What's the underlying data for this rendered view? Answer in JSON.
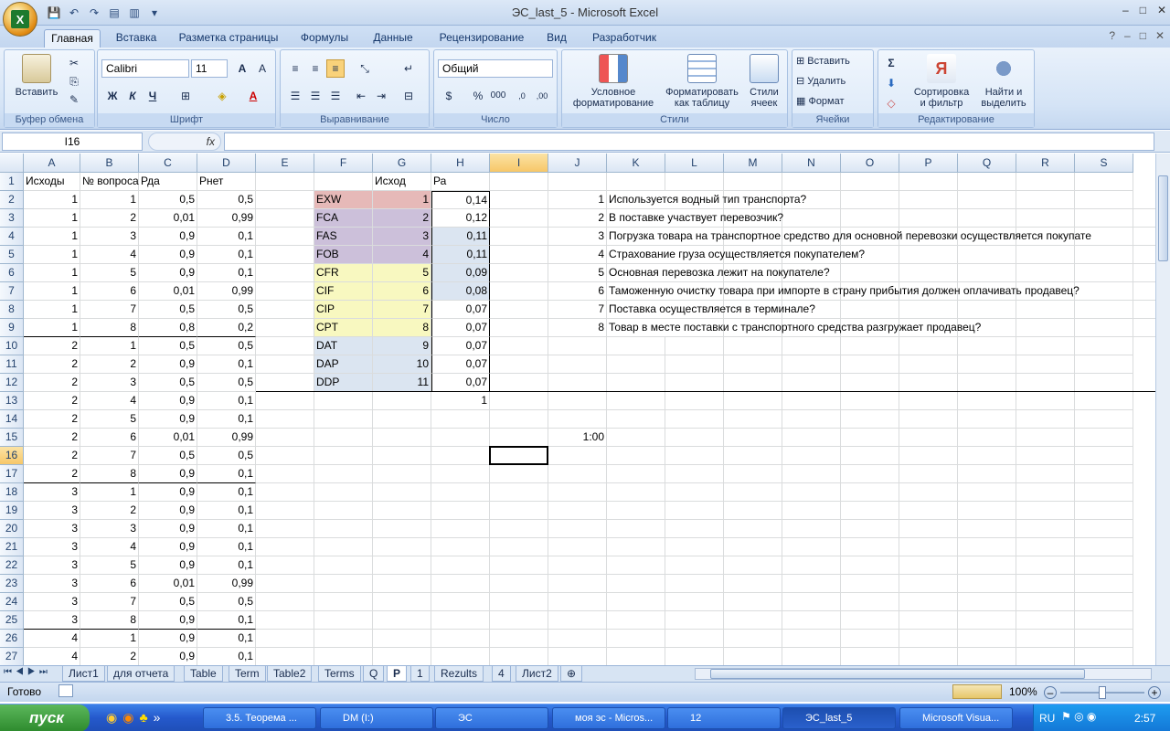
{
  "window": {
    "title": "ЭС_last_5 - Microsoft Excel",
    "controls": [
      "–",
      "□",
      "✕"
    ]
  },
  "ribbon_tabs": [
    "Главная",
    "Вставка",
    "Разметка страницы",
    "Формулы",
    "Данные",
    "Рецензирование",
    "Вид",
    "Разработчик"
  ],
  "ribbon": {
    "clipboard": {
      "label": "Буфер обмена",
      "paste": "Вставить"
    },
    "font": {
      "label": "Шрифт",
      "name": "Calibri",
      "size": "11",
      "bold": "Ж",
      "italic": "К",
      "underline": "Ч"
    },
    "alignment": {
      "label": "Выравнивание"
    },
    "number": {
      "label": "Число",
      "format": "Общий",
      "percent": "%",
      "thousands": "000"
    },
    "styles": {
      "label": "Стили",
      "cond1": "Условное",
      "cond2": "форматирование",
      "table1": "Форматировать",
      "table2": "как таблицу",
      "cells1": "Стили",
      "cells2": "ячеек"
    },
    "cells": {
      "label": "Ячейки",
      "insert": "Вставить",
      "delete": "Удалить",
      "format": "Формат"
    },
    "editing": {
      "label": "Редактирование",
      "sort1": "Сортировка",
      "sort2": "и фильтр",
      "find1": "Найти и",
      "find2": "выделить"
    }
  },
  "formula_bar": {
    "name_box": "I16",
    "fx": "fx",
    "content": ""
  },
  "columns": [
    "A",
    "B",
    "C",
    "D",
    "E",
    "F",
    "G",
    "H",
    "I",
    "J",
    "K",
    "L",
    "M",
    "N",
    "O",
    "P",
    "Q",
    "R",
    "S"
  ],
  "rows": [
    [
      "Исходы",
      "№ вопроса",
      "Рда",
      "Рнет",
      "",
      "",
      "Исход",
      "Ра",
      "",
      "",
      "",
      "",
      "",
      "",
      "",
      "",
      "",
      "",
      ""
    ],
    [
      "1",
      "1",
      "0,5",
      "0,5",
      "",
      "EXW",
      "1",
      "0,14",
      "",
      "1",
      "Используется водный тип транспорта?",
      "",
      "",
      "",
      "",
      "",
      "",
      "",
      ""
    ],
    [
      "1",
      "2",
      "0,01",
      "0,99",
      "",
      "FCA",
      "2",
      "0,12",
      "",
      "2",
      "В поставке  участвует перевозчик?",
      "",
      "",
      "",
      "",
      "",
      "",
      "",
      ""
    ],
    [
      "1",
      "3",
      "0,9",
      "0,1",
      "",
      "FAS",
      "3",
      "0,11",
      "",
      "3",
      "Погрузка товара на транспортное средство для основной перевозки  осуществляется покупате",
      "",
      "",
      "",
      "",
      "",
      "",
      "",
      ""
    ],
    [
      "1",
      "4",
      "0,9",
      "0,1",
      "",
      "FOB",
      "4",
      "0,11",
      "",
      "4",
      "Страхование  груза осуществляется покупателем?",
      "",
      "",
      "",
      "",
      "",
      "",
      "",
      ""
    ],
    [
      "1",
      "5",
      "0,9",
      "0,1",
      "",
      "CFR",
      "5",
      "0,09",
      "",
      "5",
      "Основная перевозка лежит на покупателе?",
      "",
      "",
      "",
      "",
      "",
      "",
      "",
      ""
    ],
    [
      "1",
      "6",
      "0,01",
      "0,99",
      "",
      "CIF",
      "6",
      "0,08",
      "",
      "6",
      "Таможенную очистку  товара при импорте в страну прибытия должен оплачивать продавец?",
      "",
      "",
      "",
      "",
      "",
      "",
      "",
      ""
    ],
    [
      "1",
      "7",
      "0,5",
      "0,5",
      "",
      "CIP",
      "7",
      "0,07",
      "",
      "7",
      "Поставка осуществляется в терминале?",
      "",
      "",
      "",
      "",
      "",
      "",
      "",
      ""
    ],
    [
      "1",
      "8",
      "0,8",
      "0,2",
      "",
      "CPT",
      "8",
      "0,07",
      "",
      "8",
      "Товар в месте поставки с транспортного средства разгружает продавец?",
      "",
      "",
      "",
      "",
      "",
      "",
      "",
      ""
    ],
    [
      "2",
      "1",
      "0,5",
      "0,5",
      "",
      "DAT",
      "9",
      "0,07",
      "",
      "",
      "",
      "",
      "",
      "",
      "",
      "",
      "",
      "",
      ""
    ],
    [
      "2",
      "2",
      "0,9",
      "0,1",
      "",
      "DAP",
      "10",
      "0,07",
      "",
      "",
      "",
      "",
      "",
      "",
      "",
      "",
      "",
      "",
      ""
    ],
    [
      "2",
      "3",
      "0,5",
      "0,5",
      "",
      "DDP",
      "11",
      "0,07",
      "",
      "",
      "",
      "",
      "",
      "",
      "",
      "",
      "",
      "",
      ""
    ],
    [
      "2",
      "4",
      "0,9",
      "0,1",
      "",
      "",
      "",
      "1",
      "",
      "",
      "",
      "",
      "",
      "",
      "",
      "",
      "",
      "",
      ""
    ],
    [
      "2",
      "5",
      "0,9",
      "0,1",
      "",
      "",
      "",
      "",
      "",
      "",
      "",
      "",
      "",
      "",
      "",
      "",
      "",
      "",
      ""
    ],
    [
      "2",
      "6",
      "0,01",
      "0,99",
      "",
      "",
      "",
      "",
      "",
      "1:00",
      "",
      "",
      "",
      "",
      "",
      "",
      "",
      "",
      ""
    ],
    [
      "2",
      "7",
      "0,5",
      "0,5",
      "",
      "",
      "",
      "",
      "",
      "",
      "",
      "",
      "",
      "",
      "",
      "",
      "",
      "",
      ""
    ],
    [
      "2",
      "8",
      "0,9",
      "0,1",
      "",
      "",
      "",
      "",
      "",
      "",
      "",
      "",
      "",
      "",
      "",
      "",
      "",
      "",
      ""
    ],
    [
      "3",
      "1",
      "0,9",
      "0,1",
      "",
      "",
      "",
      "",
      "",
      "",
      "",
      "",
      "",
      "",
      "",
      "",
      "",
      "",
      ""
    ],
    [
      "3",
      "2",
      "0,9",
      "0,1",
      "",
      "",
      "",
      "",
      "",
      "",
      "",
      "",
      "",
      "",
      "",
      "",
      "",
      "",
      ""
    ],
    [
      "3",
      "3",
      "0,9",
      "0,1",
      "",
      "",
      "",
      "",
      "",
      "",
      "",
      "",
      "",
      "",
      "",
      "",
      "",
      "",
      ""
    ],
    [
      "3",
      "4",
      "0,9",
      "0,1",
      "",
      "",
      "",
      "",
      "",
      "",
      "",
      "",
      "",
      "",
      "",
      "",
      "",
      "",
      ""
    ],
    [
      "3",
      "5",
      "0,9",
      "0,1",
      "",
      "",
      "",
      "",
      "",
      "",
      "",
      "",
      "",
      "",
      "",
      "",
      "",
      "",
      ""
    ],
    [
      "3",
      "6",
      "0,01",
      "0,99",
      "",
      "",
      "",
      "",
      "",
      "",
      "",
      "",
      "",
      "",
      "",
      "",
      "",
      "",
      ""
    ],
    [
      "3",
      "7",
      "0,5",
      "0,5",
      "",
      "",
      "",
      "",
      "",
      "",
      "",
      "",
      "",
      "",
      "",
      "",
      "",
      "",
      ""
    ],
    [
      "3",
      "8",
      "0,9",
      "0,1",
      "",
      "",
      "",
      "",
      "",
      "",
      "",
      "",
      "",
      "",
      "",
      "",
      "",
      "",
      ""
    ],
    [
      "4",
      "1",
      "0,9",
      "0,1",
      "",
      "",
      "",
      "",
      "",
      "",
      "",
      "",
      "",
      "",
      "",
      "",
      "",
      "",
      ""
    ],
    [
      "4",
      "2",
      "0,9",
      "0,1",
      "",
      "",
      "",
      "",
      "",
      "",
      "",
      "",
      "",
      "",
      "",
      "",
      "",
      "",
      ""
    ]
  ],
  "sheet_tabs": [
    "Лист1",
    "для отчета",
    "Table",
    "Term",
    "Table2",
    "Terms",
    "Q",
    "P",
    "1",
    "Rezults",
    "4",
    "Лист2"
  ],
  "active_sheet": "P",
  "status": {
    "ready": "Готово",
    "zoom": "100%"
  },
  "taskbar": {
    "start": "пуск",
    "tasks": [
      "3.5. Теорема ...",
      "DM (I:)",
      "ЭС",
      "моя эс - Micros...",
      "12",
      "ЭС_last_5",
      "Microsoft Visua..."
    ],
    "lang": "RU",
    "clock": "2:57"
  },
  "colors": {
    "exw": "#e6b9b8",
    "fca": "#ccc0da",
    "cfr": "#f8f8c0",
    "dat": "#dbe5f1",
    "h_fill": "#dbe5f1"
  }
}
